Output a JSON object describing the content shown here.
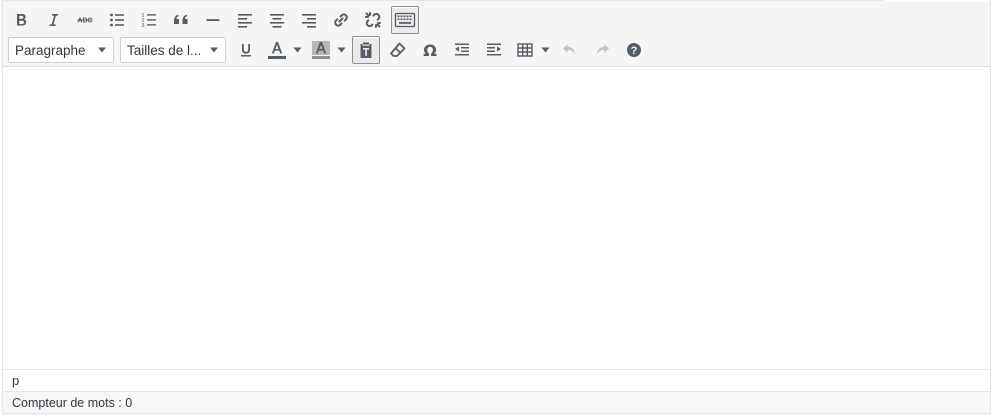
{
  "toolbar": {
    "row1": [
      {
        "name": "bold-button",
        "icon": "bold-icon"
      },
      {
        "name": "italic-button",
        "icon": "italic-icon"
      },
      {
        "name": "strikethrough-button",
        "icon": "strikethrough-icon"
      },
      {
        "name": "bullet-list-button",
        "icon": "bullet-list-icon"
      },
      {
        "name": "numbered-list-button",
        "icon": "numbered-list-icon"
      },
      {
        "name": "blockquote-button",
        "icon": "quote-icon"
      },
      {
        "name": "horizontal-rule-button",
        "icon": "horizontal-line-icon"
      },
      {
        "name": "align-left-button",
        "icon": "align-left-icon"
      },
      {
        "name": "align-center-button",
        "icon": "align-center-icon"
      },
      {
        "name": "align-right-button",
        "icon": "align-right-icon"
      },
      {
        "name": "insert-link-button",
        "icon": "link-icon"
      },
      {
        "name": "remove-link-button",
        "icon": "unlink-icon"
      },
      {
        "name": "toolbar-toggle-button",
        "icon": "keyboard-icon",
        "active": true
      }
    ],
    "format_select": {
      "label": "Paragraphe"
    },
    "size_select": {
      "label": "Tailles de l..."
    },
    "row2": [
      {
        "name": "underline-button",
        "icon": "underline-icon"
      },
      {
        "name": "text-color-button",
        "icon": "text-color-icon"
      },
      {
        "name": "background-color-button",
        "icon": "background-color-icon"
      },
      {
        "name": "paste-as-text-button",
        "icon": "paste-text-icon",
        "active": true
      },
      {
        "name": "clear-formatting-button",
        "icon": "eraser-icon"
      },
      {
        "name": "special-character-button",
        "icon": "omega-icon"
      },
      {
        "name": "outdent-button",
        "icon": "outdent-icon"
      },
      {
        "name": "indent-button",
        "icon": "indent-icon"
      },
      {
        "name": "table-button",
        "icon": "table-icon"
      },
      {
        "name": "undo-button",
        "icon": "undo-icon",
        "disabled": true
      },
      {
        "name": "redo-button",
        "icon": "redo-icon",
        "disabled": true
      },
      {
        "name": "help-button",
        "icon": "help-icon"
      }
    ]
  },
  "colors": {
    "text_color": "#555d66",
    "background_color": "#8c8f94",
    "toolbar_bg": "#f5f5f5",
    "border": "#dcdcde"
  },
  "editor": {
    "content": ""
  },
  "pathbar": {
    "path": "p"
  },
  "statusbar": {
    "word_count": "Compteur de mots : 0"
  }
}
